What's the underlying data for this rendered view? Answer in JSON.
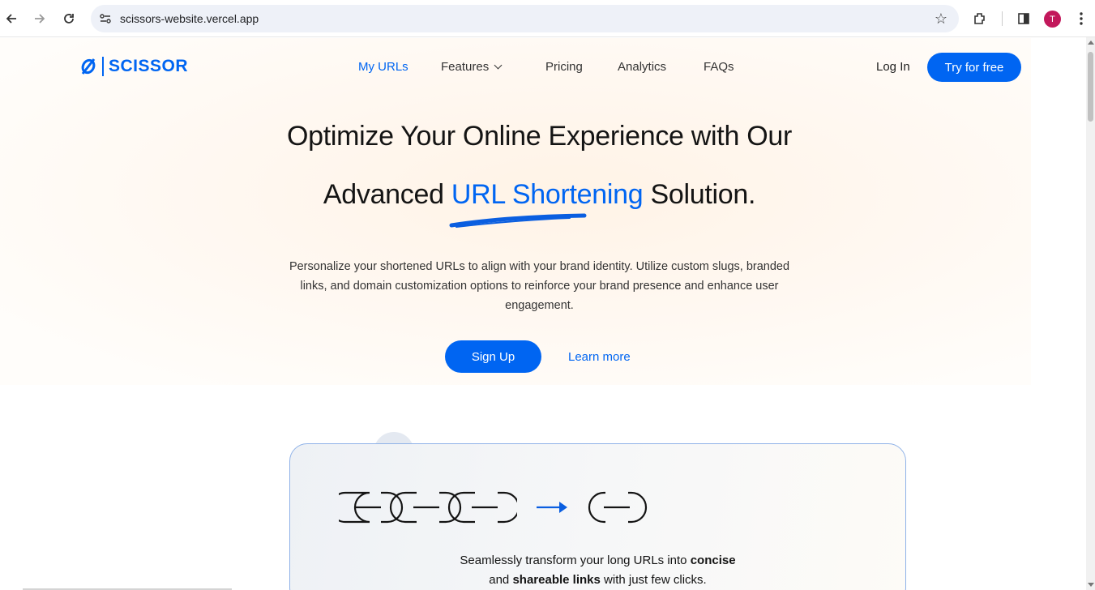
{
  "browser": {
    "url": "scissors-website.vercel.app",
    "profile_initial": "T"
  },
  "brand": {
    "name": "SCISSOR",
    "color": "#0065f2"
  },
  "nav": {
    "items": [
      {
        "label": "My URLs",
        "active": true
      },
      {
        "label": "Features",
        "has_dropdown": true
      },
      {
        "label": "Pricing"
      },
      {
        "label": "Analytics"
      },
      {
        "label": "FAQs"
      }
    ],
    "login": "Log In",
    "cta": "Try for free"
  },
  "hero": {
    "line1": "Optimize Your Online Experience with Our",
    "line2_before": "Advanced ",
    "line2_highlight": "URL Shortening",
    "line2_after": " Solution.",
    "subtitle": "Personalize your shortened URLs to align with your brand identity. Utilize custom slugs, branded links, and domain customization options to reinforce your brand presence and enhance user engagement.",
    "primary_button": "Sign Up",
    "secondary_link": "Learn more"
  },
  "feature_card": {
    "text_part1": "Seamlessly transform your long URLs into ",
    "bold1": "concise",
    "text_part2": "and ",
    "bold2": "shareable links",
    "text_part3": " with just few clicks."
  },
  "icons": [
    "back-arrow-icon",
    "forward-arrow-icon",
    "reload-icon",
    "site-settings-icon",
    "bookmark-star-icon",
    "extensions-icon",
    "side-panel-icon",
    "menu-dots-icon",
    "link-logo-icon",
    "chain-link-icon",
    "right-arrow-icon"
  ]
}
